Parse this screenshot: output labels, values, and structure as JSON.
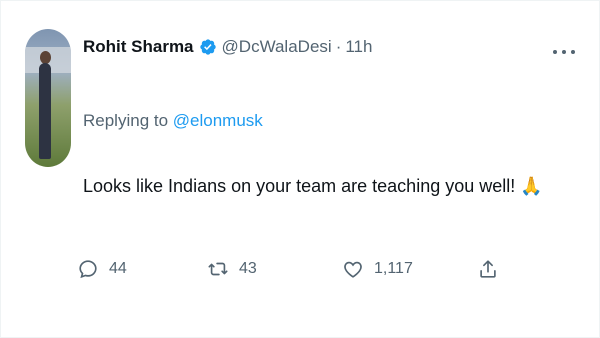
{
  "tweet": {
    "author_name": "Rohit Sharma",
    "handle": "@DcWalaDesi",
    "separator": "·",
    "time": "11h",
    "replying_prefix": "Replying to ",
    "replying_to": "@elonmusk",
    "text": "Looks like Indians on your team are teaching you well!",
    "emoji": "🙏",
    "accent_color": "#1d9bf0"
  },
  "actions": {
    "reply_count": "44",
    "retweet_count": "43",
    "like_count": "1,117"
  },
  "icons": {
    "more": "more-dots-icon",
    "verified": "verified-badge-icon",
    "reply": "reply-bubble-icon",
    "retweet": "retweet-icon",
    "like": "heart-icon",
    "share": "share-icon"
  }
}
